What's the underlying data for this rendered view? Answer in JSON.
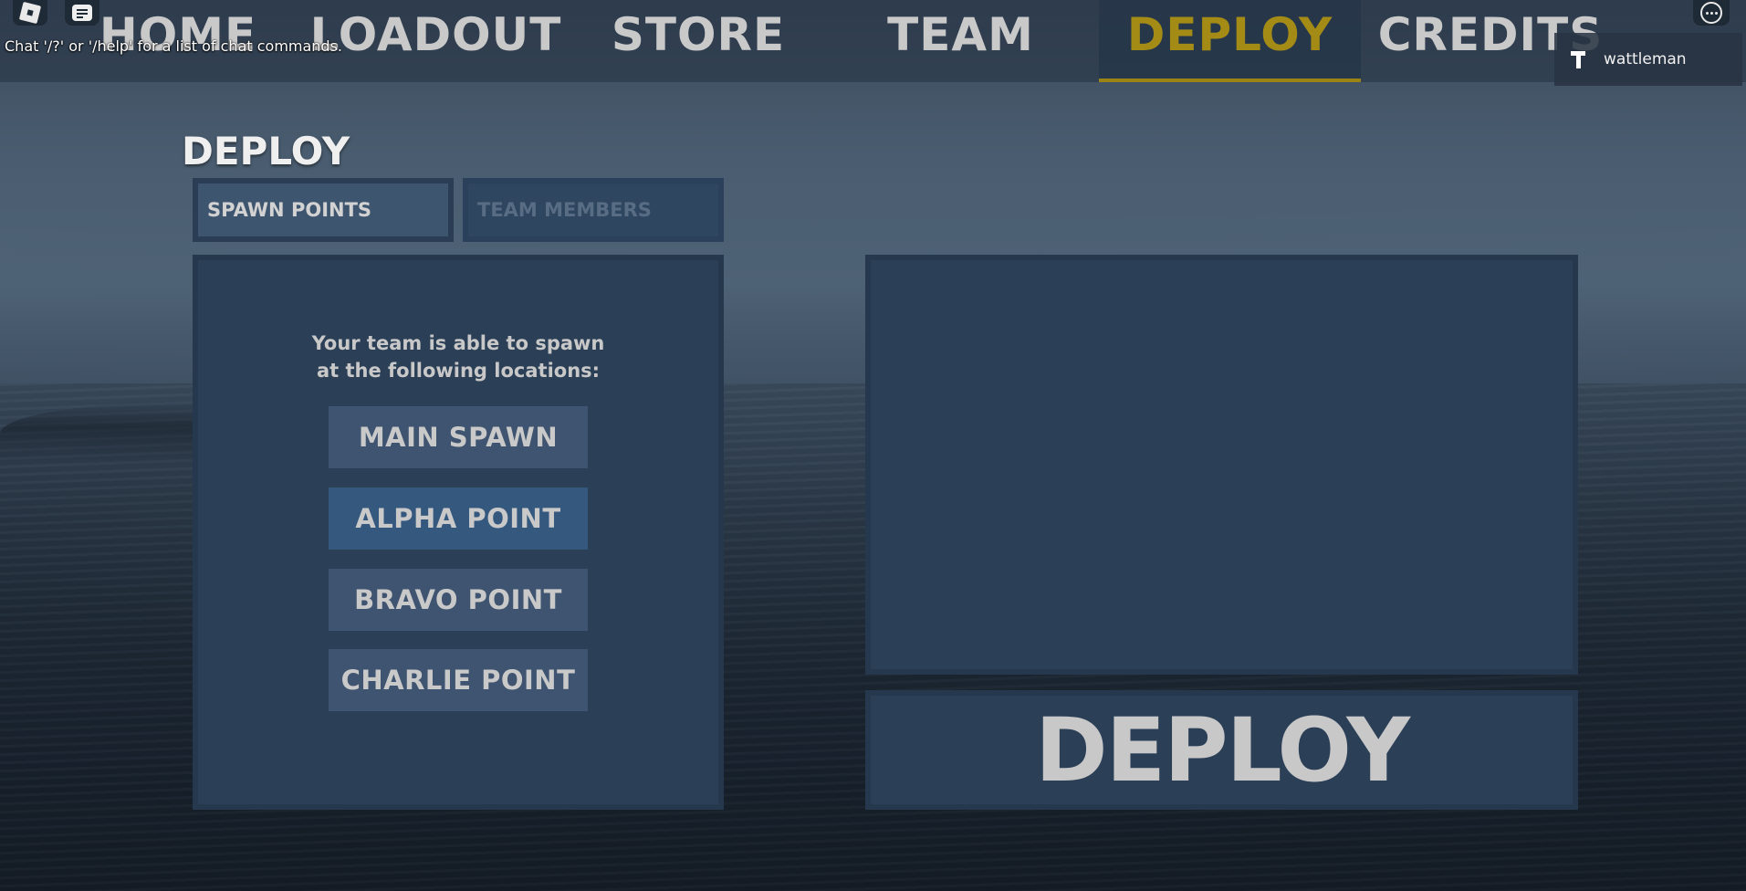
{
  "nav": {
    "tabs": [
      {
        "label": "HOME"
      },
      {
        "label": "LOADOUT"
      },
      {
        "label": "STORE"
      },
      {
        "label": "TEAM"
      },
      {
        "label": "DEPLOY",
        "active": true
      },
      {
        "label": "CREDITS"
      }
    ],
    "active_color": "#a48b16"
  },
  "chat": {
    "hint": "Chat '/?' or '/help' for a list of chat commands."
  },
  "player": {
    "name": "wattleman",
    "icon": "team-t-icon"
  },
  "deploy": {
    "title": "DEPLOY",
    "subtabs": [
      {
        "label": "SPAWN POINTS",
        "active": true
      },
      {
        "label": "TEAM MEMBERS",
        "active": false
      }
    ],
    "intro_line1": "Your team is able to spawn",
    "intro_line2": "at the following locations:",
    "spawns": [
      {
        "label": "MAIN SPAWN",
        "selected": false
      },
      {
        "label": "ALPHA POINT",
        "selected": true
      },
      {
        "label": "BRAVO POINT",
        "selected": false
      },
      {
        "label": "CHARLIE POINT",
        "selected": false
      }
    ],
    "deploy_button": "DEPLOY"
  },
  "icons": {
    "roblox": "roblox-logo-icon",
    "chat": "chat-icon",
    "more": "more-options-icon"
  }
}
